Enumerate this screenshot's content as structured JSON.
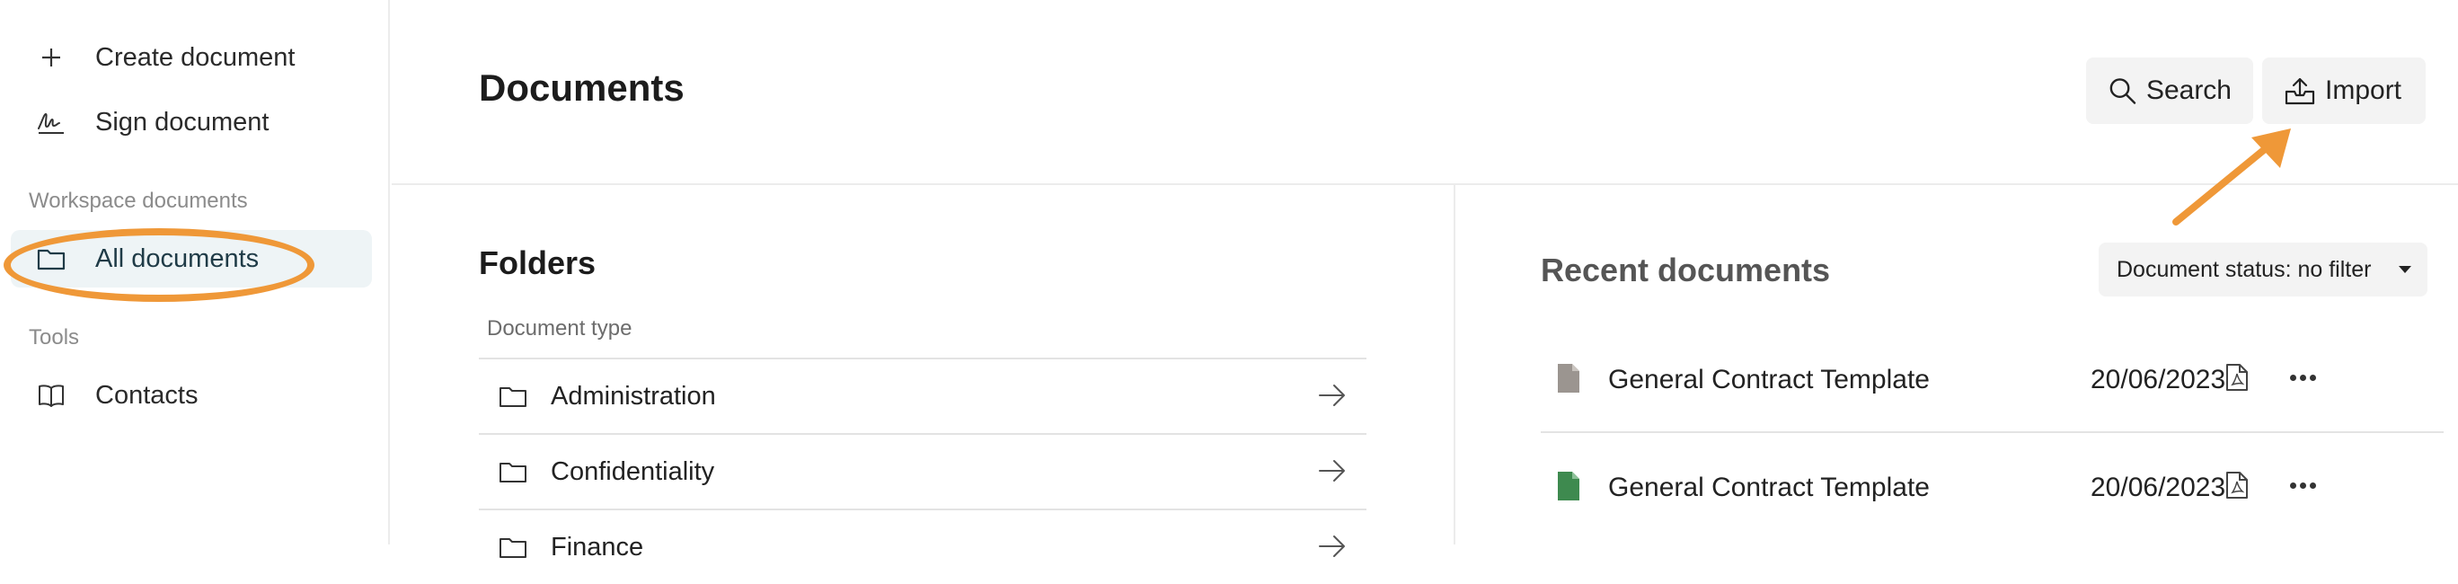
{
  "sidebar": {
    "create_label": "Create document",
    "sign_label": "Sign document",
    "section_workspace": "Workspace documents",
    "all_documents_label": "All documents",
    "section_tools": "Tools",
    "contacts_label": "Contacts"
  },
  "header": {
    "title": "Documents",
    "search_label": "Search",
    "import_label": "Import"
  },
  "folders": {
    "title": "Folders",
    "column_label": "Document type",
    "items": [
      {
        "label": "Administration"
      },
      {
        "label": "Confidentiality"
      },
      {
        "label": "Finance"
      }
    ]
  },
  "recent": {
    "title": "Recent documents",
    "status_filter": "Document status: no filter",
    "rows": [
      {
        "name": "General Contract Template",
        "date": "20/06/2023",
        "icon_color": "#9b9590"
      },
      {
        "name": "General Contract Template",
        "date": "20/06/2023",
        "icon_color": "#3e8a4f"
      }
    ]
  },
  "annotation": {
    "color": "#ef9838"
  }
}
